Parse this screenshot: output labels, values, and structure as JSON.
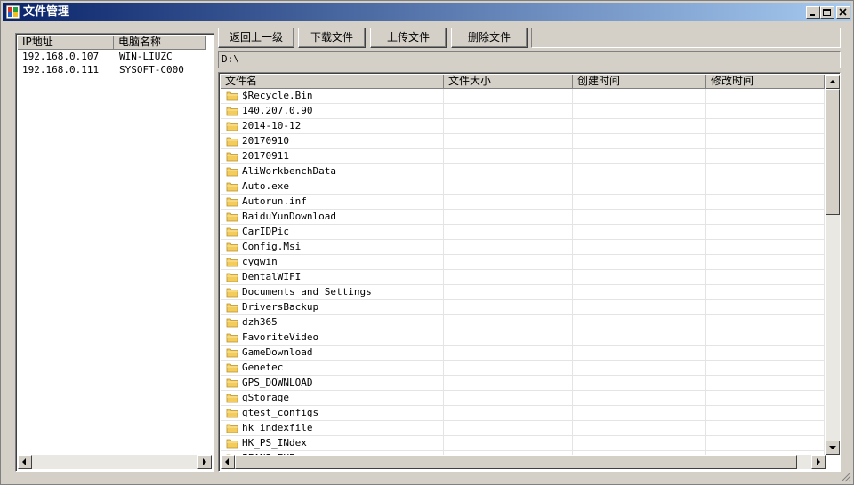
{
  "window": {
    "title": "文件管理",
    "accent": "#0a246a"
  },
  "hosts": {
    "columns": [
      "IP地址",
      "电脑名称"
    ],
    "rows": [
      {
        "ip": "192.168.0.107",
        "name": "WIN-LIUZC"
      },
      {
        "ip": "192.168.0.111",
        "name": "SYSOFT-C000"
      }
    ]
  },
  "toolbar": {
    "back_label": "返回上一级",
    "download_label": "下载文件",
    "upload_label": "上传文件",
    "delete_label": "删除文件"
  },
  "path": {
    "value": "D:\\"
  },
  "files": {
    "columns": [
      "文件名",
      "文件大小",
      "创建时间",
      "修改时间"
    ],
    "folder_icon": "folder-icon",
    "rows": [
      {
        "name": "$Recycle.Bin"
      },
      {
        "name": "140.207.0.90"
      },
      {
        "name": "2014-10-12"
      },
      {
        "name": "20170910"
      },
      {
        "name": "20170911"
      },
      {
        "name": "AliWorkbenchData"
      },
      {
        "name": "Auto.exe"
      },
      {
        "name": "Autorun.inf"
      },
      {
        "name": "BaiduYunDownload"
      },
      {
        "name": "CarIDPic"
      },
      {
        "name": "Config.Msi"
      },
      {
        "name": "cygwin"
      },
      {
        "name": "DentalWIFI"
      },
      {
        "name": "Documents and Settings"
      },
      {
        "name": "DriversBackup"
      },
      {
        "name": "dzh365"
      },
      {
        "name": "FavoriteVideo"
      },
      {
        "name": "GameDownload"
      },
      {
        "name": "Genetec"
      },
      {
        "name": "GPS_DOWNLOAD"
      },
      {
        "name": "gStorage"
      },
      {
        "name": "gtest_configs"
      },
      {
        "name": "hk_indexfile"
      },
      {
        "name": "HK_PS_INdex"
      },
      {
        "name": "IFANI_EXE"
      }
    ]
  }
}
